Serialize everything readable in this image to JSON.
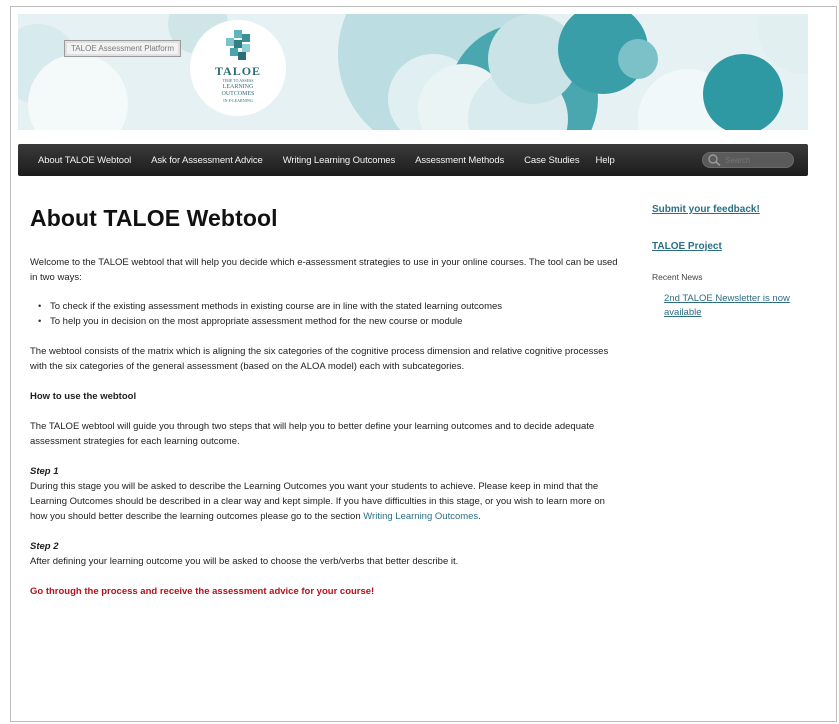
{
  "banner": {
    "platform_label": "TALOE Assessment Platform",
    "logo": {
      "name": "TALOE",
      "tagline_lines": [
        "TIME TO ASSESS",
        "LEARNING",
        "OUTCOMES",
        "IN E-LEARNING"
      ]
    }
  },
  "nav": {
    "items": [
      {
        "label": "About TALOE Webtool"
      },
      {
        "label": "Ask for Assessment Advice"
      },
      {
        "label": "Writing Learning Outcomes"
      },
      {
        "label": "Assessment Methods"
      },
      {
        "label": "Case Studies"
      },
      {
        "label": "Help"
      }
    ],
    "search_placeholder": "Search"
  },
  "main": {
    "title": "About TALOE Webtool",
    "intro": "Welcome to the TALOE webtool that will help you decide which e-assessment strategies to use in your online courses. The tool can be used in two ways:",
    "bullets": [
      "To check if the existing assessment methods in existing course are in line with the stated learning outcomes",
      "To help you in decision on the most appropriate assessment method for the new course or module"
    ],
    "matrix_text": "The webtool consists of the matrix which is aligning the six categories of the cognitive process dimension and relative cognitive processes with the six categories of the general assessment (based on the ALOA model) each with subcategories.",
    "how_to_heading": "How to use the webtool",
    "how_to_text": "The TALOE webtool will guide you through two steps that will help you to better define your learning outcomes and to decide adequate assessment strategies for each learning outcome.",
    "step1_title": "Step 1",
    "step1_text": "During this stage you will be asked to describe the Learning Outcomes you want your students to achieve. Please keep in mind that the Learning Outcomes should be described in a clear way and kept simple. If you have difficulties in this stage, or you wish to learn more on how you should better describe the learning outcomes please go to the section ",
    "step1_link": "Writing Learning Outcomes",
    "step1_end": ".",
    "step2_title": "Step 2",
    "step2_text": "After defining your learning outcome you will be asked to choose the verb/verbs that better describe it.",
    "cta": "Go through the process and receive the assessment advice for your course!"
  },
  "sidebar": {
    "feedback_link": "Submit your feedback!",
    "project_link": "TALOE Project",
    "recent_news_heading": "Recent News",
    "news": [
      {
        "label": "2nd TALOE Newsletter is now available"
      }
    ]
  },
  "colors": {
    "teal_dark": "#2c9aa6",
    "teal_mid": "#7cc0c7",
    "teal_light": "#c5e2e6",
    "nav_bg": "#262626",
    "link": "#2c6f87",
    "cta": "#b3121b"
  }
}
